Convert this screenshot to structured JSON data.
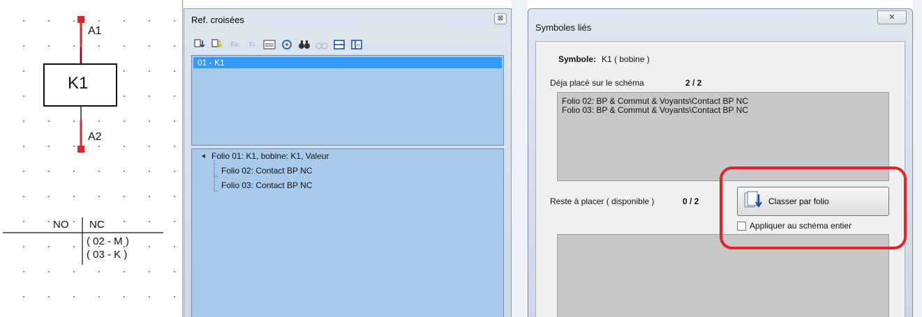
{
  "schema": {
    "coil_label": "K1",
    "terminal_top": "A1",
    "terminal_bottom": "A2",
    "col_no": "NO",
    "col_nc": "NC",
    "ref_1": "( 02 - M )",
    "ref_2": "( 03 - K )"
  },
  "ref_panel": {
    "title": "Ref. croisées",
    "close_icon": "⊠",
    "list_selected": "01 - K1",
    "tree_root": "Folio 01: K1, bobine: K1, Valeur",
    "tree_children": [
      "Folio 02: Contact BP NC",
      "Folio 03: Contact BP NC"
    ],
    "toolbar_small": [
      "Fo",
      "Fl"
    ]
  },
  "dialog": {
    "title": "Symboles liés",
    "close_icon": "✕",
    "symbole_label": "Symbole:",
    "symbole_value": "K1 ( bobine )",
    "placed_label": "Déja placé sur le schéma",
    "placed_count": "2 / 2",
    "placed_items": [
      "Folio 02: BP & Commut & Voyants\\Contact BP NC",
      "Folio 03: BP & Commut & Voyants\\Contact BP NC"
    ],
    "remaining_label": "Reste à placer ( disponible )",
    "remaining_count": "0 / 2",
    "classer_button": "Classer par folio",
    "apply_checkbox": "Appliquer au schéma entier"
  },
  "colors": {
    "highlight": "#e0242a",
    "selection": "#3399ff",
    "list_bg": "#a8c9ea"
  }
}
